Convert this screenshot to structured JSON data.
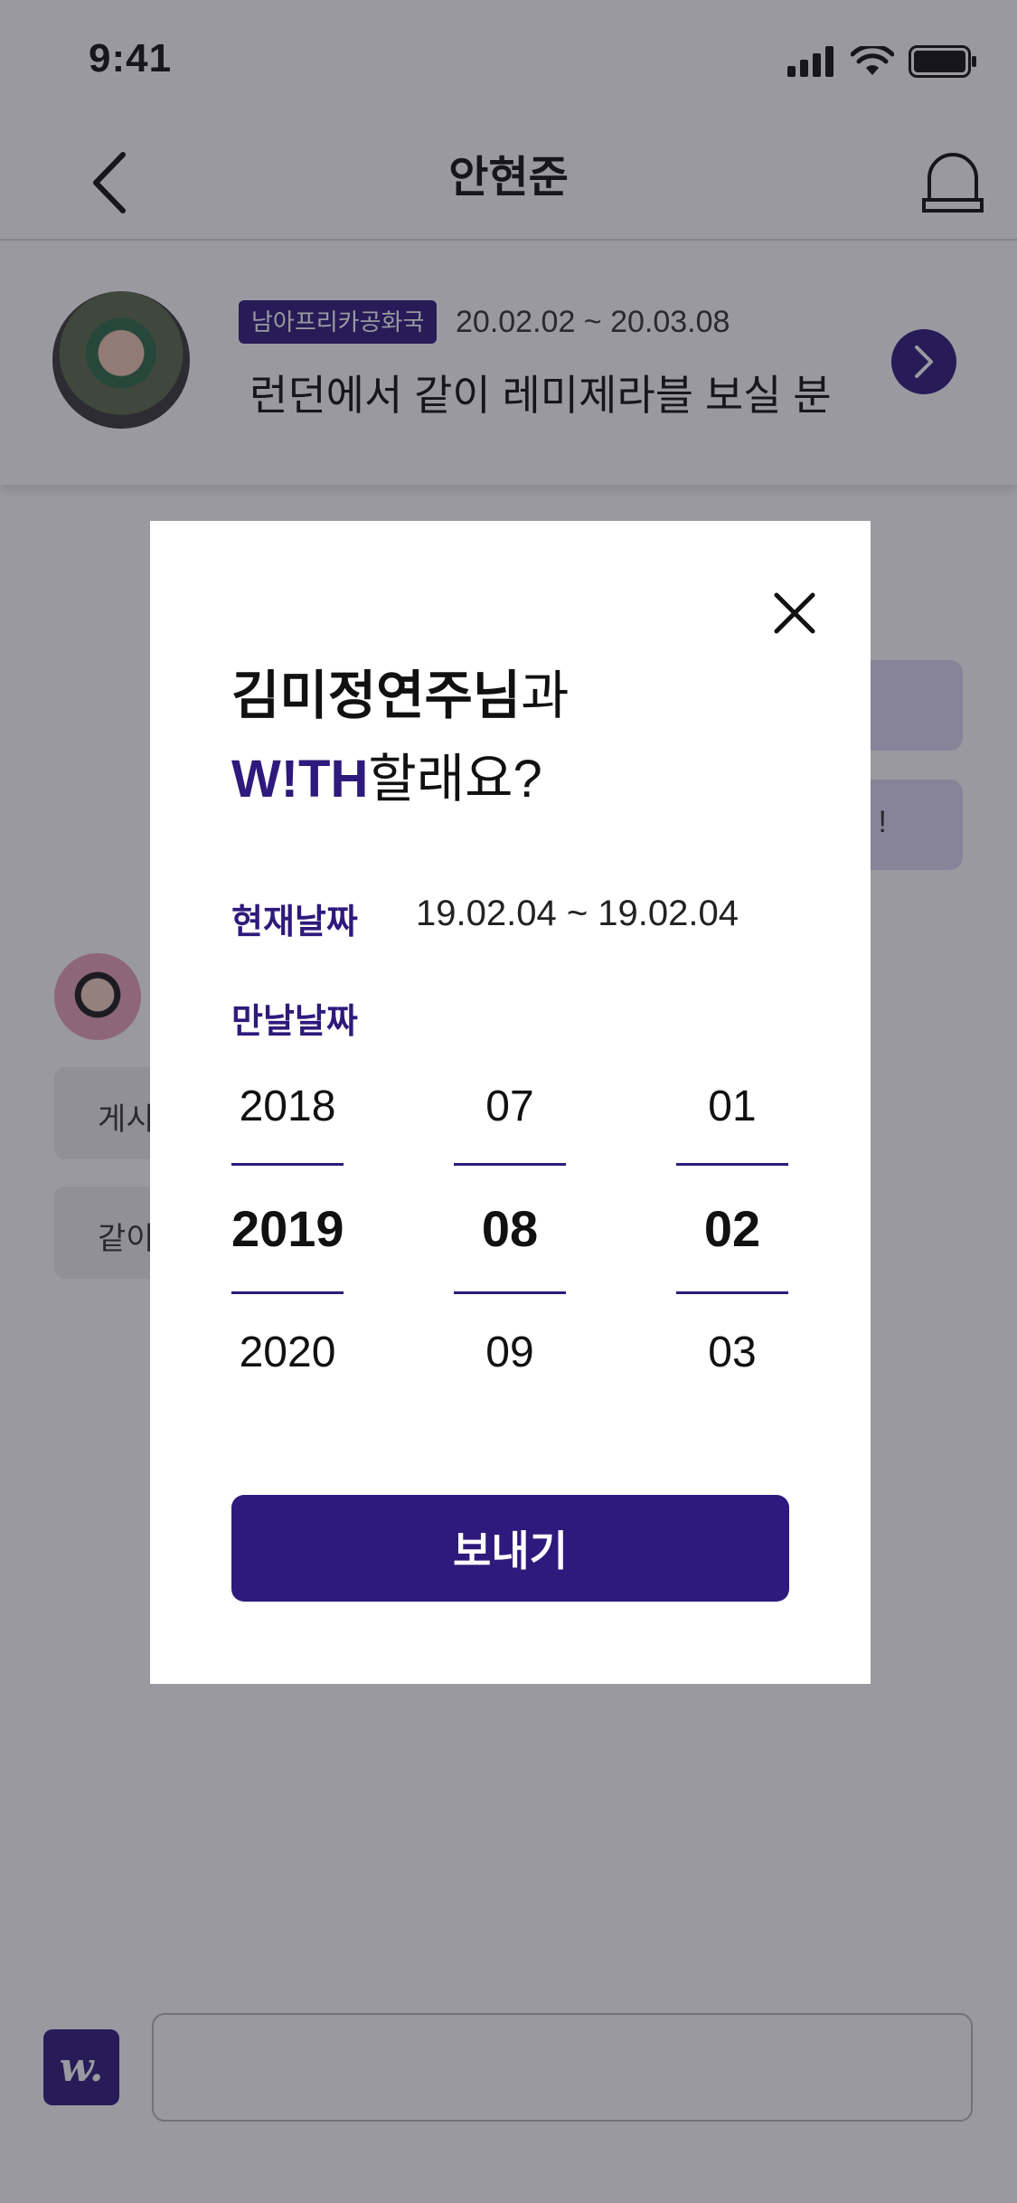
{
  "status_bar": {
    "time": "9:41"
  },
  "header": {
    "title": "안현준"
  },
  "post": {
    "badge": "남아프리카공화국",
    "dates": "20.02.02 ~ 20.03.08",
    "title": "런던에서 같이 레미제라블 보실 분"
  },
  "chat": {
    "right_bubble_2_fragment": "!",
    "left_bubble_1_fragment": "게시",
    "left_bubble_2_fragment": "같이"
  },
  "modal": {
    "title_name": "김미정연주님",
    "title_suffix": "과",
    "title_brand": "W!TH",
    "title_question": "할래요?",
    "current_date_label": "현재날짜",
    "current_date_value": "19.02.04 ~ 19.02.04",
    "meet_date_label": "만날날짜",
    "picker": {
      "years": [
        "2018",
        "2019",
        "2020"
      ],
      "months": [
        "07",
        "08",
        "09"
      ],
      "days": [
        "01",
        "02",
        "03"
      ],
      "selected_index": 1
    },
    "send_label": "보내기"
  },
  "input": {
    "placeholder": ""
  },
  "colors": {
    "brand": "#2e1a7c",
    "overlay": "rgba(30,28,45,0.45)"
  }
}
